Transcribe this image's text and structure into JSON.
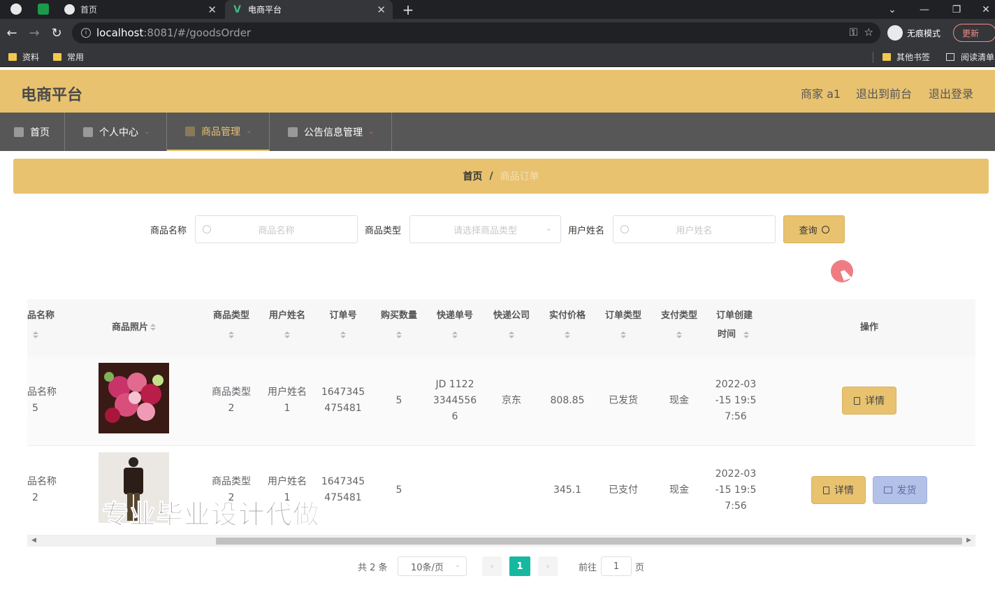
{
  "browser": {
    "tabs": [
      {
        "label": "首页"
      },
      {
        "label": "电商平台"
      }
    ],
    "url_host": "localhost",
    "url_path": ":8081/#/goodsOrder",
    "profile_label": "无痕模式",
    "update_label": "更新",
    "bookmarks": [
      {
        "label": "资料"
      },
      {
        "label": "常用"
      }
    ],
    "other_bookmarks": "其他书签",
    "reading_list": "阅读清单"
  },
  "header": {
    "title": "电商平台",
    "user": "商家 a1",
    "to_front": "退出到前台",
    "logout": "退出登录"
  },
  "menu": {
    "items": [
      {
        "label": "首页"
      },
      {
        "label": "个人中心"
      },
      {
        "label": "商品管理"
      },
      {
        "label": "公告信息管理"
      }
    ]
  },
  "breadcrumb": {
    "home": "首页",
    "separator": "/",
    "current": "商品订单"
  },
  "search": {
    "name_label": "商品名称",
    "name_placeholder": "商品名称",
    "type_label": "商品类型",
    "type_placeholder": "请选择商品类型",
    "user_label": "用户姓名",
    "user_placeholder": "用户姓名",
    "query_button": "查询"
  },
  "table": {
    "headers": {
      "name": "品名称",
      "photo": "商品照片",
      "type": "商品类型",
      "user": "用户姓名",
      "order_no": "订单号",
      "qty": "购买数量",
      "express_no": "快递单号",
      "express_co": "快递公司",
      "price": "实付价格",
      "order_type": "订单类型",
      "pay_type": "支付类型",
      "created_1": "订单创建",
      "created_2": "时间",
      "actions": "操作"
    },
    "rows": [
      {
        "name_1": "品名称",
        "name_2": "5",
        "type_1": "商品类型",
        "type_2": "2",
        "user_1": "用户姓名",
        "user_2": "1",
        "order_1": "1647345",
        "order_2": "475481",
        "qty": "5",
        "express_1": "JD 1122",
        "express_2": "3344556",
        "express_3": "6",
        "express_co": "京东",
        "price": "808.85",
        "order_type": "已发货",
        "pay_type": "现金",
        "created_1": "2022-03",
        "created_2": "-15 19:5",
        "created_3": "7:56",
        "detail": "详情"
      },
      {
        "name_1": "品名称",
        "name_2": "2",
        "type_1": "商品类型",
        "type_2": "2",
        "user_1": "用户姓名",
        "user_2": "1",
        "order_1": "1647345",
        "order_2": "475481",
        "qty": "5",
        "price": "345.1",
        "order_type": "已支付",
        "pay_type": "现金",
        "created_1": "2022-03",
        "created_2": "-15 19:5",
        "created_3": "7:56",
        "detail": "详情",
        "ship": "发货"
      }
    ]
  },
  "watermark": "专业毕业设计代做",
  "pagination": {
    "total": "共 2 条",
    "page_size": "10条/页",
    "current": "1",
    "goto_prefix": "前往",
    "goto_value": "1",
    "goto_suffix": "页"
  },
  "colors": {
    "accent": "#e8c26f",
    "nav_bg": "#575757",
    "page_active": "#17b8a0",
    "ship_button": "#b3c0e8"
  }
}
